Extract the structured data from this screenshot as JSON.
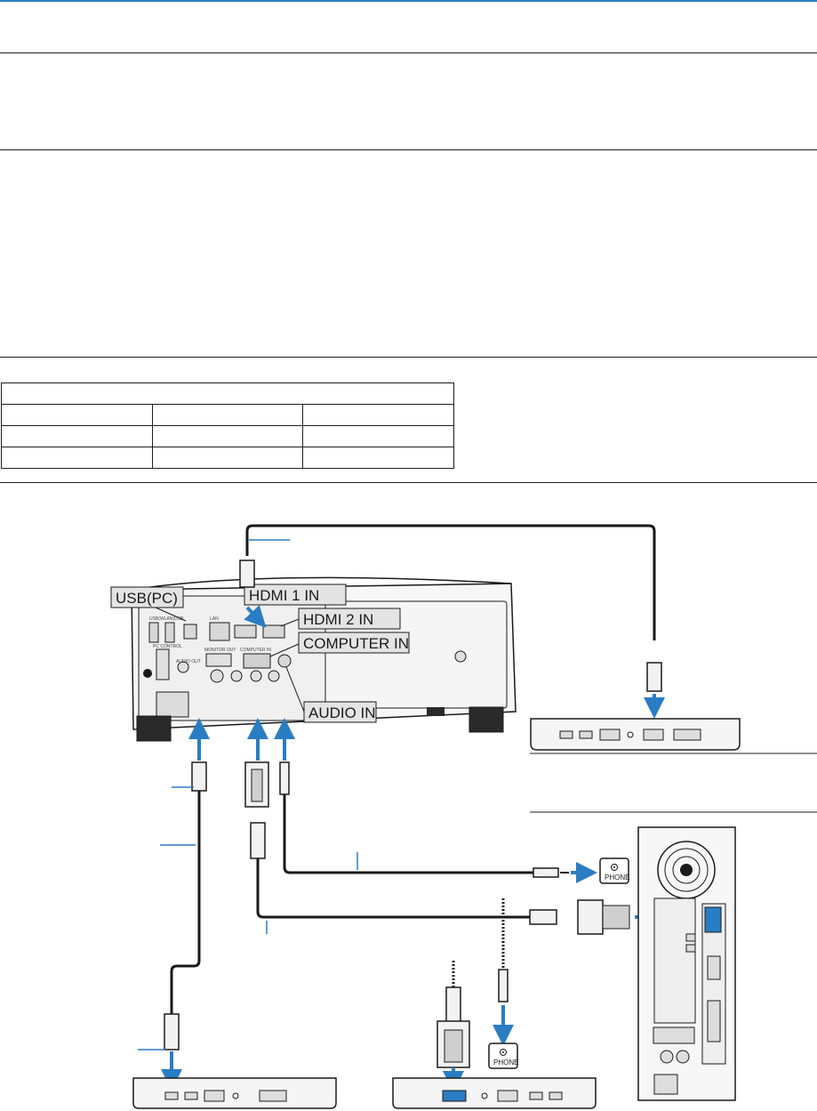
{
  "labels": {
    "usb_pc": "USB(PC)",
    "hdmi1": "HDMI 1 IN",
    "hdmi2": "HDMI 2 IN",
    "computer_in": "COMPUTER IN",
    "audio_in": "AUDIO IN",
    "phone": "PHONE"
  },
  "colors": {
    "rule": "#1f1f1f",
    "accent": "#2a7dc3",
    "label_bg": "#e4e4e4"
  }
}
